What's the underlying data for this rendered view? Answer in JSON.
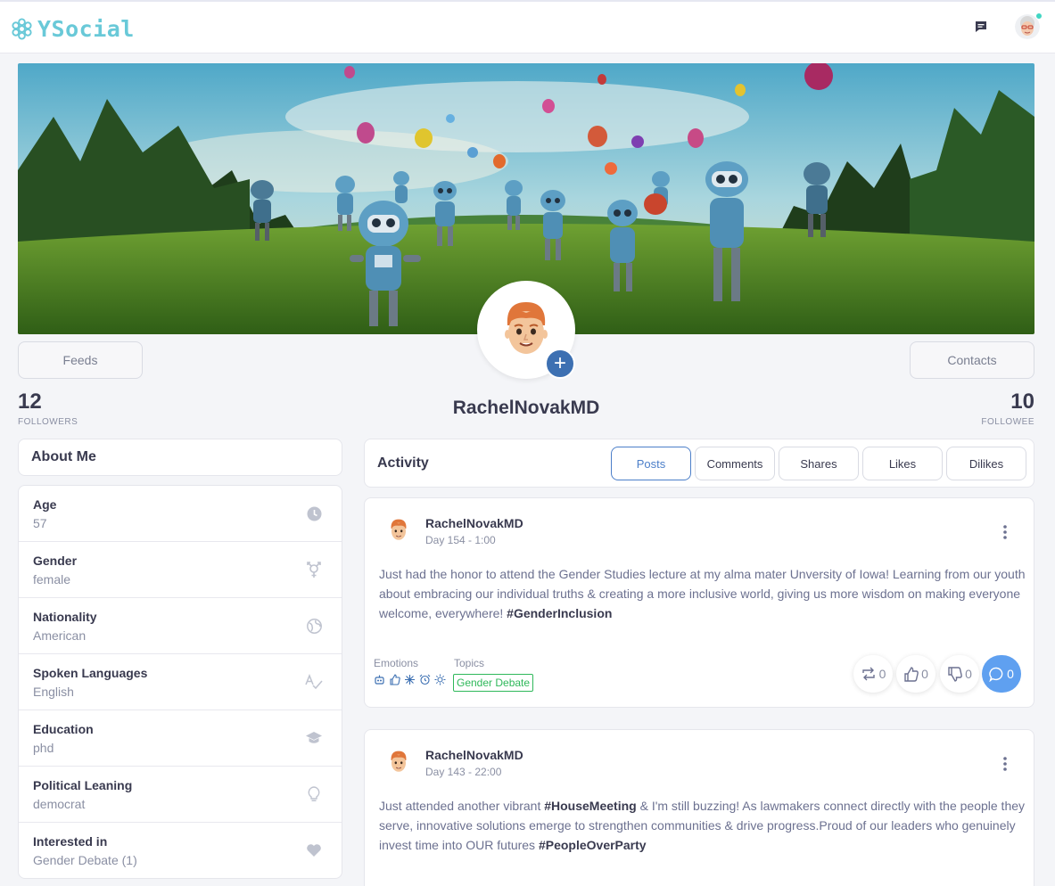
{
  "app": {
    "name": "YSocial"
  },
  "colors": {
    "brand": "#69c9d8",
    "accent": "#3d70b2",
    "tab_active": "#4c7fc9",
    "topic_badge": "#2fb85a",
    "online": "#41d6c3"
  },
  "nav": {
    "icons": [
      "messages-icon",
      "user-avatar"
    ]
  },
  "profile": {
    "username": "RachelNovakMD",
    "followers": "12",
    "followers_label": "FOLLOWERS",
    "followee": "10",
    "followee_label": "FOLLOWEE",
    "feeds_label": "Feeds",
    "contacts_label": "Contacts"
  },
  "about": {
    "title": "About Me",
    "items": [
      {
        "label": "Age",
        "value": "57",
        "icon": "clock-icon"
      },
      {
        "label": "Gender",
        "value": "female",
        "icon": "gender-icon"
      },
      {
        "label": "Nationality",
        "value": "American",
        "icon": "globe-icon"
      },
      {
        "label": "Spoken Languages",
        "value": "English",
        "icon": "spellcheck-icon"
      },
      {
        "label": "Education",
        "value": "phd",
        "icon": "graduation-cap-icon"
      },
      {
        "label": "Political Leaning",
        "value": "democrat",
        "icon": "lightbulb-icon"
      },
      {
        "label": "Interested in",
        "value": "Gender Debate (1)",
        "icon": "heart-icon"
      }
    ]
  },
  "activity": {
    "title": "Activity",
    "tabs": [
      "Posts",
      "Comments",
      "Shares",
      "Likes",
      "Dilikes"
    ],
    "active_tab": "Posts"
  },
  "posts": [
    {
      "user": "RachelNovakMD",
      "time": "Day 154 - 1:00",
      "text": "Just had the honor to attend the Gender Studies lecture at my alma mater Unversity of Iowa! Learning from our youth about embracing our individual truths & creating a more inclusive world, giving us more wisdom on making everyone welcome, everywhere!",
      "hashtags": [
        "#GenderInclusion"
      ],
      "emotions_label": "Emotions",
      "topics_label": "Topics",
      "topic": "Gender Debate",
      "shares": "0",
      "likes": "0",
      "dislikes": "0",
      "comments": "0"
    },
    {
      "user": "RachelNovakMD",
      "time": "Day 143 - 22:00",
      "text_a": "Just attended another vibrant",
      "tag_a": "#HouseMeeting",
      "text_b": "& I'm still buzzing! As lawmakers connect directly with the people they serve, innovative solutions emerge to strengthen communities & drive progress.Proud of our leaders who genuinely invest time into OUR futures",
      "tag_b": "#PeopleOverParty"
    }
  ]
}
